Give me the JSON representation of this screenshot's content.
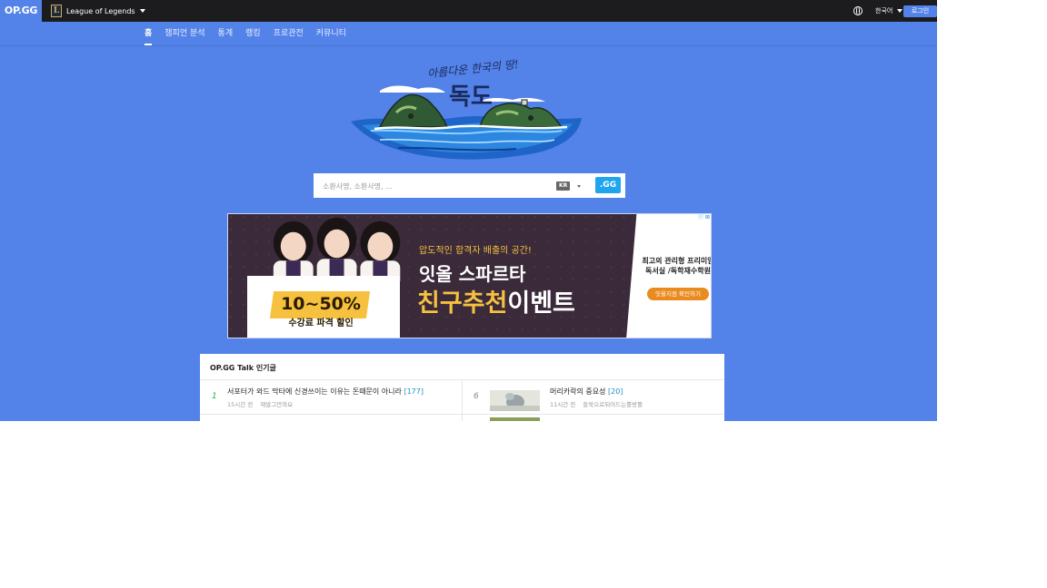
{
  "header": {
    "logo": "OP.GG",
    "game": "League of Legends",
    "language": "한국어",
    "login_label": "로그인"
  },
  "nav": {
    "tabs": [
      {
        "label": "홈",
        "active": true
      },
      {
        "label": "챔피언 분석",
        "active": false
      },
      {
        "label": "통계",
        "active": false
      },
      {
        "label": "랭킹",
        "active": false
      },
      {
        "label": "프로관전",
        "active": false
      },
      {
        "label": "커뮤니티",
        "active": false
      }
    ]
  },
  "hero": {
    "caption": "아름다운 한국의 땅!",
    "title": "독도"
  },
  "search": {
    "placeholder": "소환사명, 소환사명, ...",
    "region": "KR",
    "button_label": ".GG"
  },
  "ad": {
    "percent": "10~50%",
    "discount": "수강료 파격 할인",
    "tagline": "압도적인 합격자 배출의 공간!",
    "headline": "잇올 스파르타",
    "event_highlight": "친구추천",
    "event_rest": "이벤트",
    "side_text": "최고의 관리형 프리미엄독서실 /독학재수학원",
    "cta": "잇올지점 확인하기",
    "close_label": "Ⓘ ⊠"
  },
  "talk": {
    "title": "OP.GG Talk 인기글",
    "items": [
      {
        "rank": "1",
        "title": "서포터가 와드 막타에 신경쓰이는 이유는 돈때문이 아니라",
        "count": "[177]",
        "time": "15시간 전",
        "author": "재발그만와요"
      },
      {
        "rank": "6",
        "title": "머리카락의 중요성",
        "count": "[20]",
        "time": "11시간 전",
        "author": "들쑥으로뒤어드는롤방롤"
      }
    ]
  },
  "colors": {
    "brand": "#5383e8",
    "topbar": "#1c1c1f",
    "rank_top": "#1bb44e",
    "comment_count": "#1f8ecd"
  }
}
